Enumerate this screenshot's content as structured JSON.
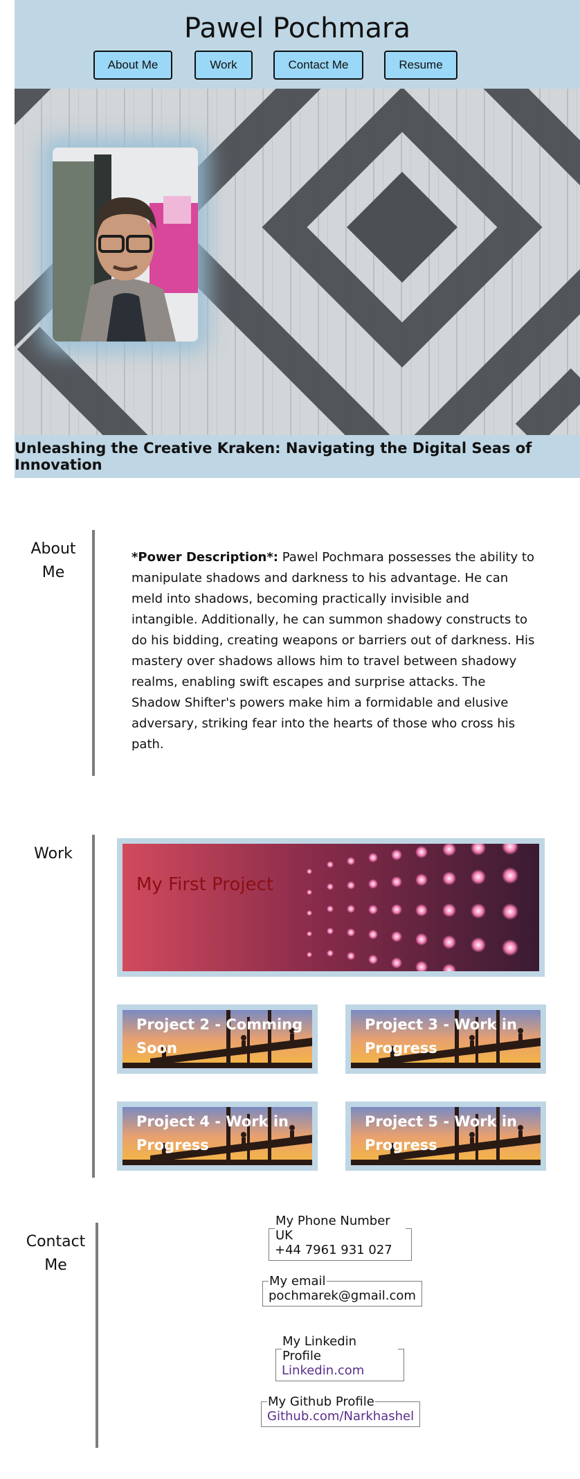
{
  "header": {
    "title": "Pawel Pochmara",
    "nav": [
      "About Me",
      "Work",
      "Contact Me",
      "Resume"
    ]
  },
  "hero": {
    "tagline": "Unleashing the Creative Kraken: Navigating the Digital Seas of Innovation"
  },
  "about": {
    "label_line1": "About",
    "label_line2": "Me",
    "lead": "*Power Description*:",
    "text": " Pawel Pochmara possesses the ability to manipulate shadows and darkness to his advantage. He can meld into shadows, becoming practically invisible and intangible. Additionally, he can summon shadowy constructs to do his bidding, creating weapons or barriers out of darkness. His mastery over shadows allows him to travel between shadowy realms, enabling swift escapes and surprise attacks. The Shadow Shifter's powers make him a formidable and elusive adversary, striking fear into the hearts of those who cross his path."
  },
  "work": {
    "label": "Work",
    "main_project": "My First Project",
    "projects": [
      "Project 2 - Comming Soon",
      "Project 3 - Work in Progress",
      "Project 4 - Work in Progress",
      "Project 5 - Work in Progress"
    ]
  },
  "contact": {
    "label_line1": "Contact",
    "label_line2": "Me",
    "phone_legend": "My Phone Number UK",
    "phone": "+44 7961 931 027",
    "email_legend": "My email",
    "email": "pochmarek@gmail.com",
    "linkedin_legend": "My Linkedin Profile",
    "linkedin": "Linkedin.com",
    "github_legend": "My Github Profile",
    "github": "Github.com/Narkhashel"
  },
  "colors": {
    "band": "#bfd6e4",
    "nav_button": "#9bd8f7",
    "rule": "#7c7c7c",
    "link": "#5a2d8c"
  }
}
